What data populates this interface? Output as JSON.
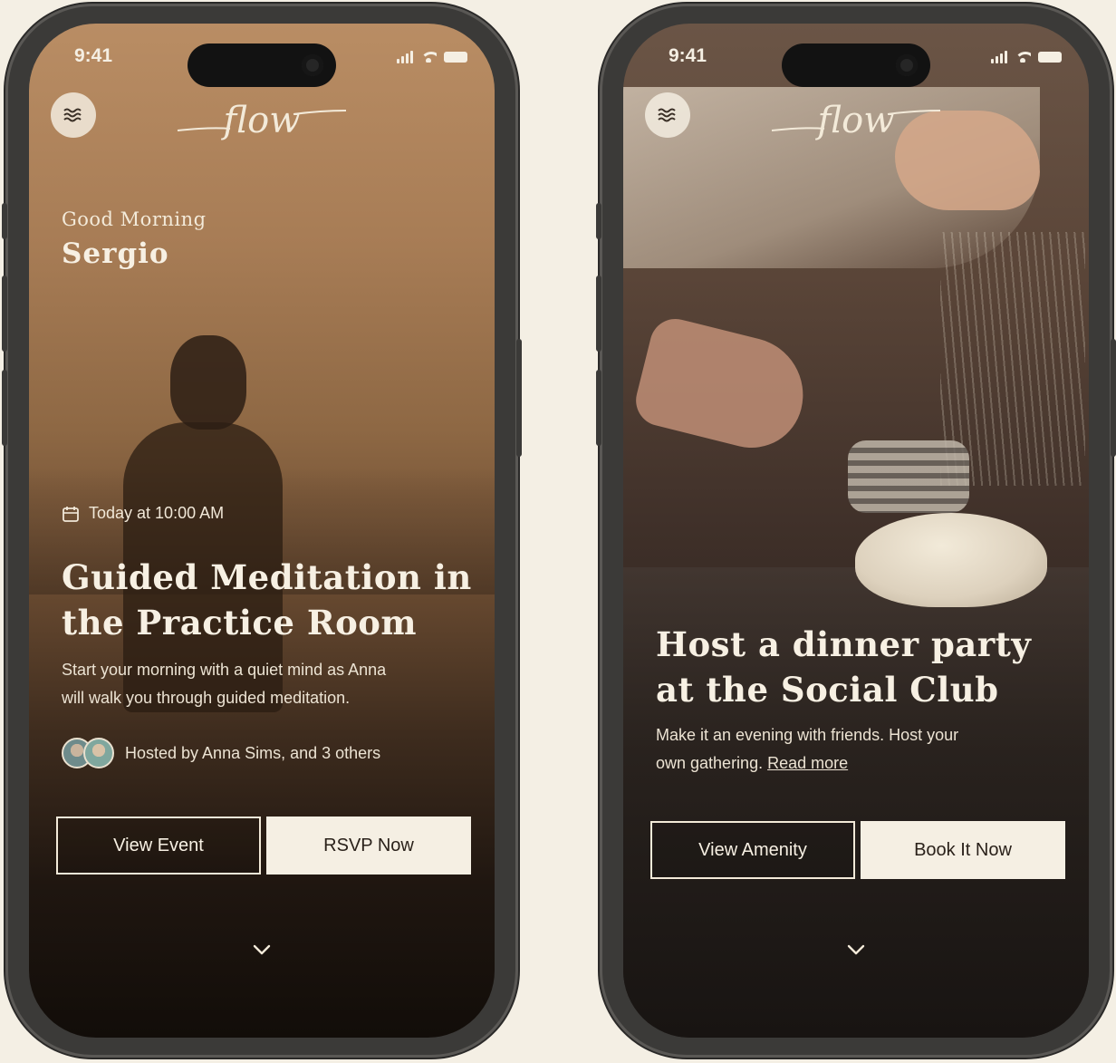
{
  "screens": [
    {
      "status_time": "9:41",
      "greeting": "Good Morning",
      "user_name": "Sergio",
      "event_date": "Today at 10:00 AM",
      "title_line1": "Guided Meditation in",
      "title_line2": "the Practice Room",
      "description_line1": "Start your morning with a quiet mind as Anna",
      "description_line2": "will walk you through guided meditation.",
      "hosts_text": "Hosted by Anna Sims, and 3 others",
      "primary_button": "View Event",
      "secondary_button": "RSVP Now"
    },
    {
      "status_time": "9:41",
      "title_line1": "Host a dinner party",
      "title_line2": "at the Social Club",
      "description_line1": "Make it an evening with friends. Host your",
      "description_line2_prefix": "own gathering.",
      "read_more": "Read more",
      "primary_button": "View Amenity",
      "secondary_button": "Book It Now"
    }
  ],
  "brand": {
    "logo_text": "flow",
    "accent": "#f5efe3",
    "background": "#f4efe4"
  },
  "icons": {
    "menu": "waves-icon",
    "date": "calendar-icon",
    "scroll": "chevron-down-icon"
  }
}
